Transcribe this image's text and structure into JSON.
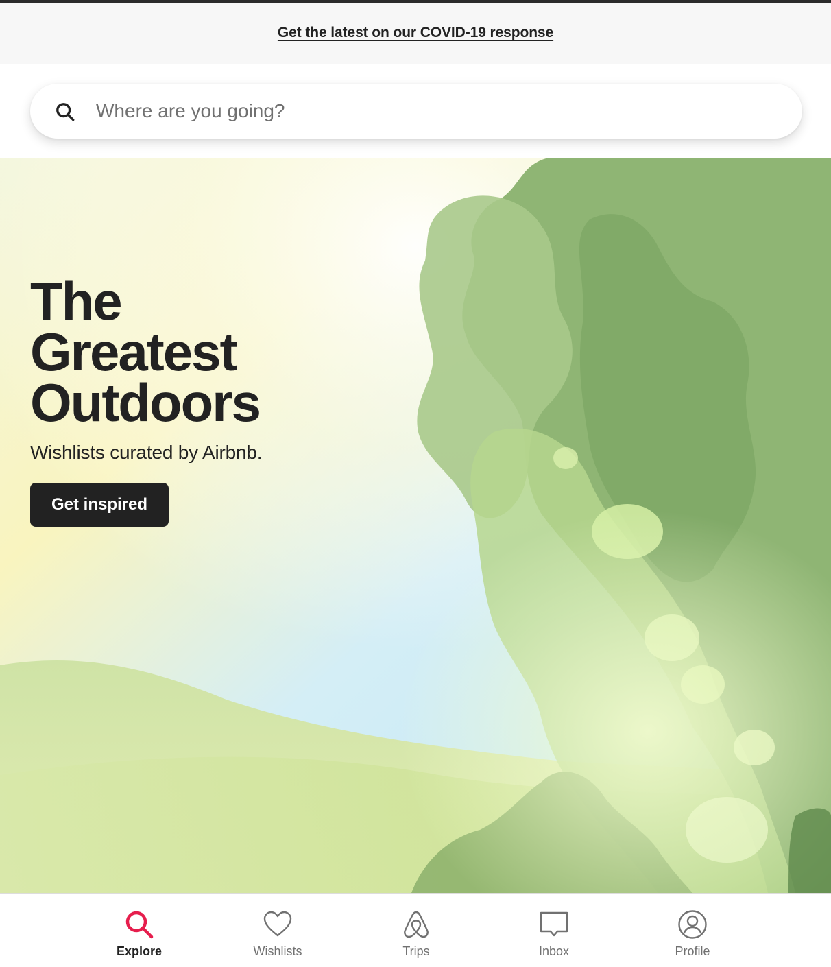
{
  "banner": {
    "link_text": "Get the latest on our COVID-19 response"
  },
  "search": {
    "placeholder": "Where are you going?",
    "icon": "search-icon"
  },
  "hero": {
    "title_lines": [
      "The",
      "Greatest",
      "Outdoors"
    ],
    "subtitle": "Wishlists curated by Airbnb.",
    "cta_label": "Get inspired",
    "image": "illustrated-landscape-trees-hills"
  },
  "tabbar": {
    "active": "explore",
    "accent_color": "#E61E4D",
    "items": [
      {
        "id": "explore",
        "label": "Explore",
        "icon": "search-icon"
      },
      {
        "id": "wishlists",
        "label": "Wishlists",
        "icon": "heart-icon"
      },
      {
        "id": "trips",
        "label": "Trips",
        "icon": "airbnb-logo-icon"
      },
      {
        "id": "inbox",
        "label": "Inbox",
        "icon": "message-icon"
      },
      {
        "id": "profile",
        "label": "Profile",
        "icon": "user-circle-icon"
      }
    ]
  },
  "colors": {
    "text": "#222222",
    "muted": "#717171",
    "banner_bg": "#F7F7F7",
    "cta_bg": "#222222"
  }
}
